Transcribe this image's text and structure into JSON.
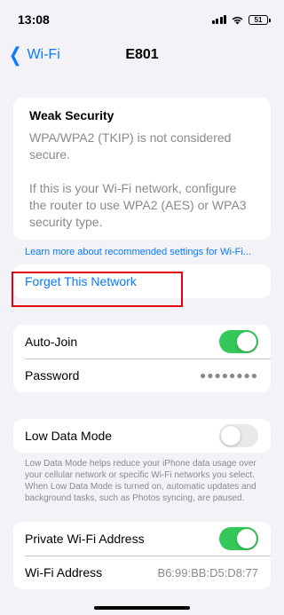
{
  "status": {
    "time": "13:08",
    "battery": "51"
  },
  "nav": {
    "back_label": "Wi-Fi",
    "title": "E801"
  },
  "warning": {
    "title": "Weak Security",
    "line1": "WPA/WPA2 (TKIP) is not considered secure.",
    "line2": "If this is your Wi-Fi network, configure the router to use WPA2 (AES) or WPA3 security type."
  },
  "learn_more": "Learn more about recommended settings for Wi-Fi...",
  "forget": "Forget This Network",
  "autojoin": {
    "label": "Auto-Join",
    "on": true
  },
  "password": {
    "label": "Password",
    "mask": "●●●●●●●●"
  },
  "low_data": {
    "label": "Low Data Mode",
    "on": false,
    "footnote": "Low Data Mode helps reduce your iPhone data usage over your cellular network or specific Wi-Fi networks you select. When Low Data Mode is turned on, automatic updates and background tasks, such as Photos syncing, are paused."
  },
  "private_address": {
    "label": "Private Wi-Fi Address",
    "on": true
  },
  "wifi_address": {
    "label": "Wi-Fi Address",
    "value": "B6:99:BB:D5:D8:77"
  },
  "colors": {
    "accent": "#0a7aff",
    "toggle_on": "#34c759",
    "highlight": "#e3000f"
  },
  "icons": [
    "cellular-signal-icon",
    "wifi-icon",
    "battery-icon",
    "chevron-left-icon"
  ]
}
